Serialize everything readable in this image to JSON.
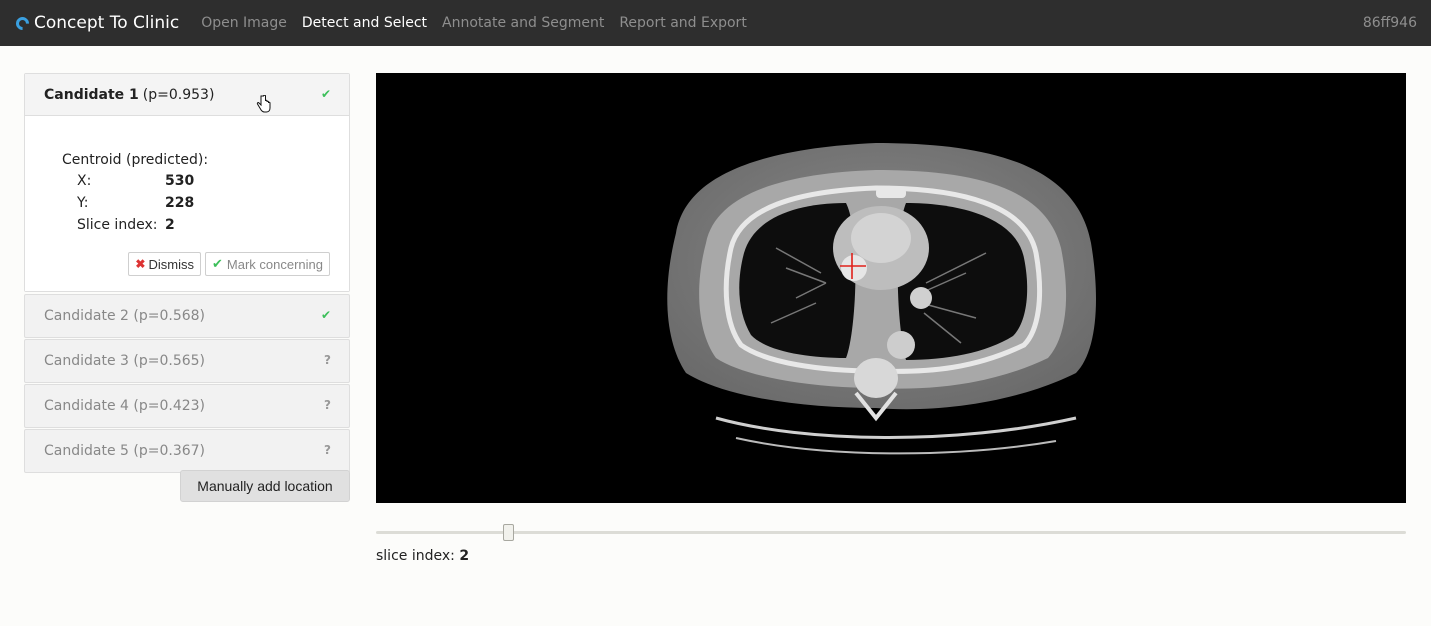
{
  "navbar": {
    "brand": "Concept To Clinic",
    "items": [
      "Open Image",
      "Detect and Select",
      "Annotate and Segment",
      "Report and Export"
    ],
    "active": "Detect and Select",
    "version": "86ff946"
  },
  "candidates": [
    {
      "name": "Candidate 1",
      "prob": "(p=0.953)",
      "status": "check"
    },
    {
      "name": "Candidate 2",
      "prob": "(p=0.568)",
      "status": "check"
    },
    {
      "name": "Candidate 3",
      "prob": "(p=0.565)",
      "status": "question"
    },
    {
      "name": "Candidate 4",
      "prob": "(p=0.423)",
      "status": "question"
    },
    {
      "name": "Candidate 5",
      "prob": "(p=0.367)",
      "status": "question"
    }
  ],
  "detail": {
    "title": "Centroid (predicted):",
    "x_label": "X:",
    "x_value": "530",
    "y_label": "Y:",
    "y_value": "228",
    "slice_label": "Slice index:",
    "slice_value": "2",
    "dismiss": "Dismiss",
    "mark": "Mark concerning"
  },
  "manual_button": "Manually add location",
  "slider": {
    "label": "slice index:",
    "value": "2"
  },
  "colors": {
    "navbar": "#2e2e2e",
    "check": "#3cbf5a",
    "accent": "#3aa0e0",
    "marker": "#e0201a"
  }
}
